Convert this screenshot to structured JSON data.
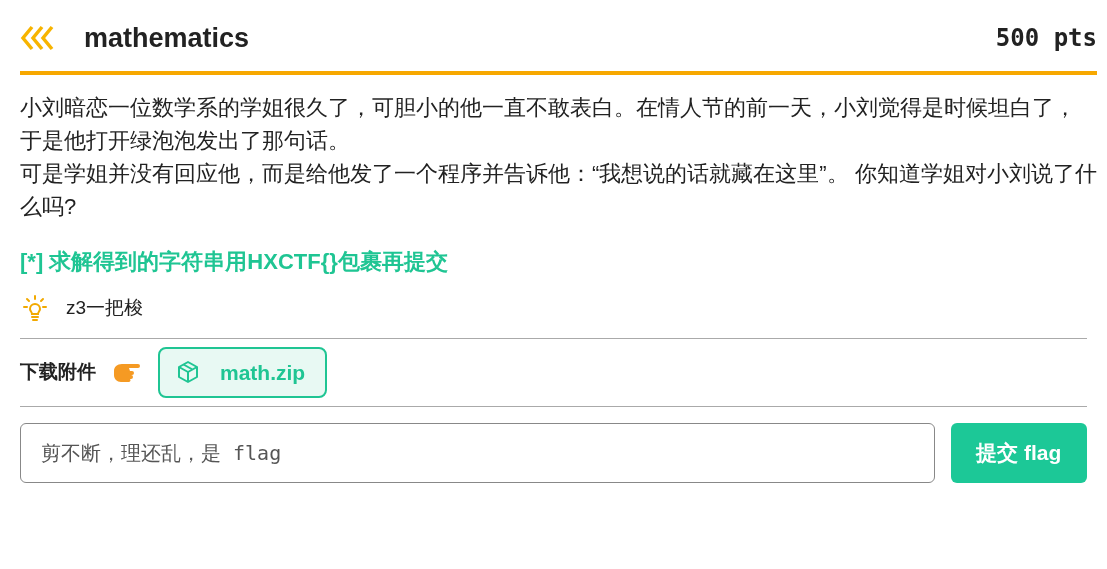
{
  "header": {
    "title": "mathematics",
    "points": "500 pts"
  },
  "description": [
    "小刘暗恋一位数学系的学姐很久了，可胆小的他一直不敢表白。在情人节的前一天，小刘觉得是时候坦白了，于是他打开绿泡泡发出了那句话。",
    "可是学姐并没有回应他，而是给他发了一个程序并告诉他：“我想说的话就藏在这里”。 你知道学姐对小刘说了什么吗?"
  ],
  "note": "[*] 求解得到的字符串用HXCTF{}包裹再提交",
  "hint": "z3一把梭",
  "attachments": {
    "label": "下载附件",
    "files": [
      "math.zip"
    ]
  },
  "flag_form": {
    "placeholder": "剪不断，理还乱，是 flag",
    "submit": "提交 flag"
  }
}
